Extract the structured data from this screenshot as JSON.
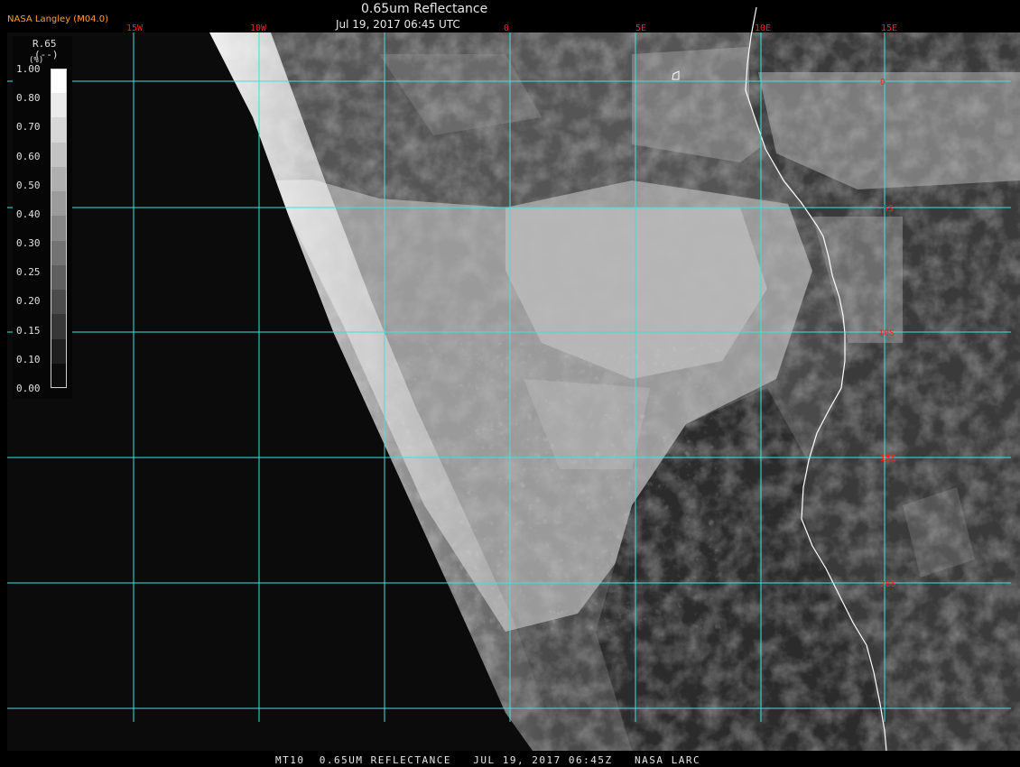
{
  "header": {
    "producer": "NASA Langley (M04.0)",
    "title": "0.65um Reflectance",
    "datetime": "Jul 19, 2017 06:45 UTC"
  },
  "footer": {
    "text": "MT10  0.65UM REFLECTANCE   JUL 19, 2017 06:45Z   NASA LARC"
  },
  "legend": {
    "parameter": "R.65",
    "unit": "(--)",
    "unit_marker": "(%)",
    "ticks": [
      "1.00",
      "0.80",
      "0.70",
      "0.60",
      "0.50",
      "0.40",
      "0.30",
      "0.25",
      "0.20",
      "0.15",
      "0.10",
      "0.00"
    ],
    "colors": [
      "#ffffff",
      "#ebebeb",
      "#d7d7d7",
      "#c3c3c3",
      "#afafaf",
      "#9b9b9b",
      "#878787",
      "#737373",
      "#5f5f5f",
      "#4b4b4b",
      "#373737",
      "#1f1f1f",
      "#0c0c0c"
    ]
  },
  "map": {
    "grid_color": "#40e0e0",
    "coast_color": "#ffffff",
    "label_color": "#ff2020",
    "longitude_labels": [
      "15W",
      "10W",
      "0",
      "5E",
      "10E",
      "15E"
    ],
    "latitude_labels": [
      "0",
      "-5S",
      "10S",
      "15S",
      "20S"
    ]
  }
}
